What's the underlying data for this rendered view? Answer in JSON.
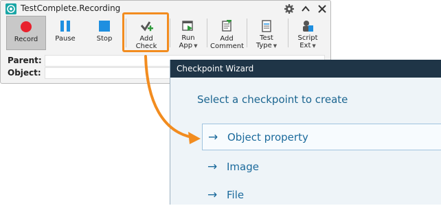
{
  "recorder": {
    "title": "TestComplete.Recording",
    "controls": {
      "settings_icon": "gear-icon",
      "collapse_icon": "chevron-up-icon",
      "close_icon": "close-icon"
    },
    "toolbar": [
      {
        "id": "record",
        "label": "Record",
        "icon": "record-icon",
        "active": true
      },
      {
        "id": "pause",
        "label": "Pause",
        "icon": "pause-icon"
      },
      {
        "id": "stop",
        "label": "Stop",
        "icon": "stop-icon"
      },
      {
        "id": "add_check",
        "label": "Add Check",
        "icon": "add-check-icon"
      },
      {
        "id": "run_app",
        "label": "Run App",
        "icon": "run-app-icon",
        "dropdown": true
      },
      {
        "id": "add_comment",
        "label": "Add Comment",
        "icon": "add-comment-icon"
      },
      {
        "id": "test_type",
        "label": "Test Type",
        "icon": "test-type-icon",
        "dropdown": true
      },
      {
        "id": "script_ext",
        "label": "Script Ext",
        "icon": "script-ext-icon",
        "dropdown": true
      }
    ],
    "fields": {
      "parent_label": "Parent:",
      "parent_value": "",
      "object_label": "Object:",
      "object_value": ""
    }
  },
  "wizard": {
    "title": "Checkpoint Wizard",
    "heading": "Select a checkpoint to create",
    "options": [
      {
        "label": "Object property",
        "selected": true
      },
      {
        "label": "Image"
      },
      {
        "label": "File"
      }
    ]
  },
  "colors": {
    "accent_orange": "#f28c1f",
    "wizard_header": "#1f3547",
    "link_blue": "#1b6a9c",
    "record_red": "#e8212d",
    "stop_blue": "#1e8fe0"
  }
}
